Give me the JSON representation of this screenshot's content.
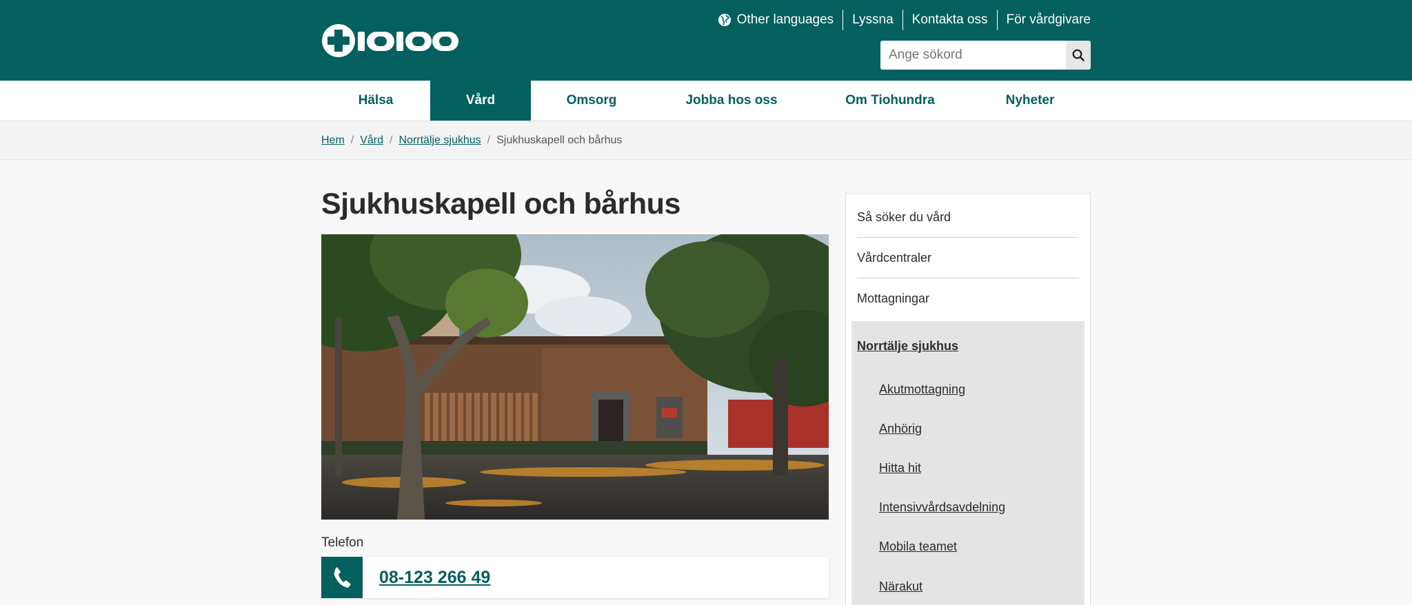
{
  "header": {
    "logo_text": "1177",
    "top_links": [
      {
        "label": "Other languages",
        "icon": "globe-icon"
      },
      {
        "label": "Lyssna"
      },
      {
        "label": "Kontakta oss"
      },
      {
        "label": "För vårdgivare"
      }
    ],
    "search": {
      "placeholder": "Ange sökord",
      "button_icon": "search-icon"
    }
  },
  "nav": {
    "items": [
      {
        "label": "Hälsa",
        "active": false
      },
      {
        "label": "Vård",
        "active": true
      },
      {
        "label": "Omsorg",
        "active": false
      },
      {
        "label": "Jobba hos oss",
        "active": false
      },
      {
        "label": "Om Tiohundra",
        "active": false
      },
      {
        "label": "Nyheter",
        "active": false
      }
    ]
  },
  "breadcrumb": {
    "items": [
      "Hem",
      "Vård",
      "Norrtälje sjukhus"
    ],
    "current": "Sjukhuskapell och bårhus"
  },
  "page": {
    "title": "Sjukhuskapell och bårhus",
    "phone_label": "Telefon",
    "phone_number": "08-123 266 49"
  },
  "sidemenu": {
    "items": [
      "Så söker du vård",
      "Vårdcentraler",
      "Mottagningar"
    ],
    "active_section": "Norrtälje sjukhus",
    "sub_items": [
      "Akutmottagning",
      "Anhörig",
      "Hitta hit",
      "Intensivvårdsavdelning",
      "Mobila teamet",
      "Närakut"
    ]
  },
  "colors": {
    "brand": "#045f5f",
    "background": "#f8f8f8",
    "sidemenu_active": "#e4e4e4"
  }
}
